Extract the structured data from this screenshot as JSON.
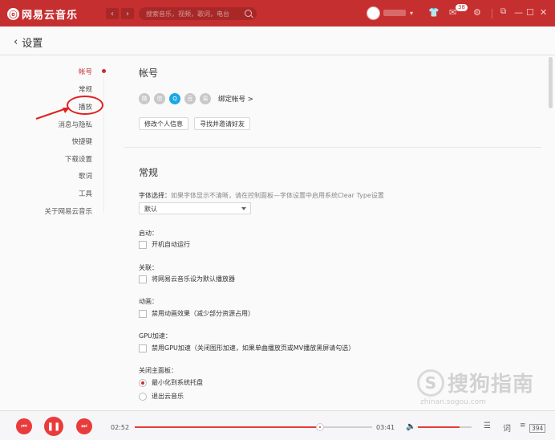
{
  "titlebar": {
    "app_name": "网易云音乐",
    "search_placeholder": "搜索音乐，视频，歌词，电台",
    "message_badge": "38",
    "accent": "#c62f2f"
  },
  "header": {
    "title": "设置"
  },
  "sidebar": {
    "items": [
      {
        "label": "帐号",
        "active": true
      },
      {
        "label": "常规"
      },
      {
        "label": "播放"
      },
      {
        "label": "消息与隐私"
      },
      {
        "label": "快捷键"
      },
      {
        "label": "下载设置"
      },
      {
        "label": "歌词"
      },
      {
        "label": "工具"
      },
      {
        "label": "关于网易云音乐"
      }
    ]
  },
  "account": {
    "title": "帐号",
    "bind_label": "绑定帐号 >",
    "edit_info": "修改个人信息",
    "find_friends": "寻找并邀请好友"
  },
  "general": {
    "title": "常规",
    "font_label": "字体选择：",
    "font_hint": "如果字体显示不清晰，请在控制面板—字体设置中启用系统Clear Type设置",
    "font_value": "默认",
    "startup_label": "启动：",
    "startup_option": "开机自动运行",
    "assoc_label": "关联：",
    "assoc_option": "将网易云音乐设为默认播放器",
    "anim_label": "动画：",
    "anim_option": "禁用动画效果（减少部分资源占用）",
    "gpu_label": "GPU加速：",
    "gpu_option": "禁用GPU加速（关闭图形加速，如果单曲播放页或MV播放黑屏请勾选）",
    "close_label": "关闭主面板：",
    "close_opt1": "最小化到系统托盘",
    "close_opt2": "退出云音乐"
  },
  "player": {
    "current_time": "02:52",
    "total_time": "03:41",
    "progress": 0.78,
    "volume": 0.78,
    "playlist_count": "394"
  },
  "watermark": {
    "text": "搜狗指南",
    "url": "zhinan.sogou.com"
  }
}
